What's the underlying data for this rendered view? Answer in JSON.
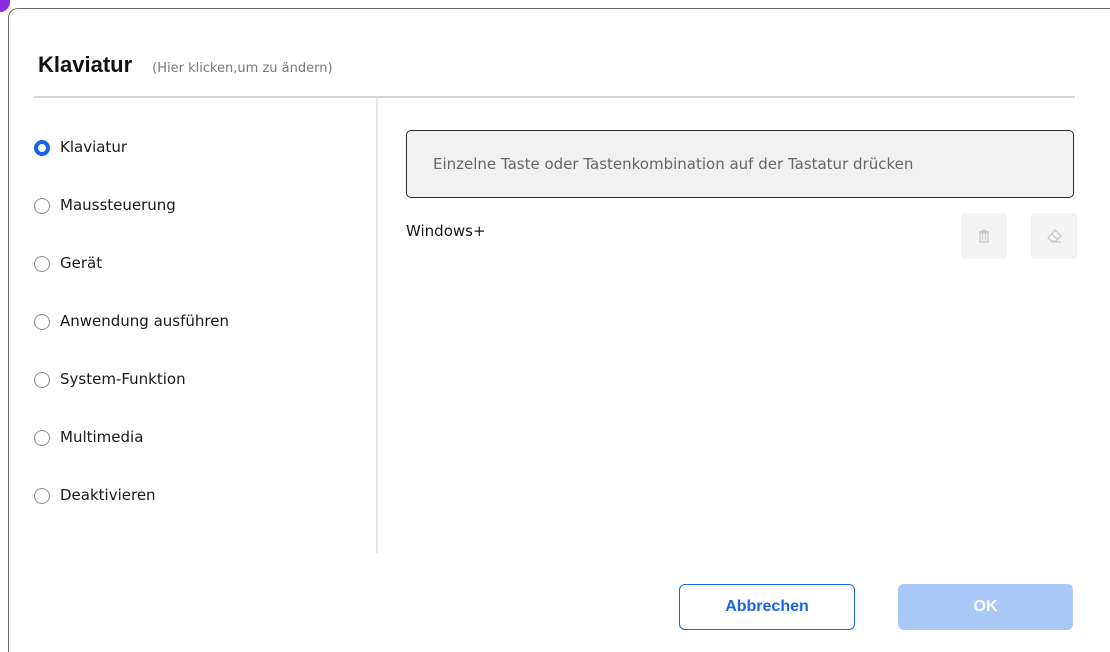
{
  "header": {
    "title": "Klaviatur",
    "hint": "(Hier klicken,um zu ändern)"
  },
  "options": [
    {
      "label": "Klaviatur",
      "selected": true
    },
    {
      "label": "Maussteuerung",
      "selected": false
    },
    {
      "label": "Gerät",
      "selected": false
    },
    {
      "label": "Anwendung ausführen",
      "selected": false
    },
    {
      "label": "System-Funktion",
      "selected": false
    },
    {
      "label": "Multimedia",
      "selected": false
    },
    {
      "label": "Deaktivieren",
      "selected": false
    }
  ],
  "key_input": {
    "value": "",
    "placeholder": "Einzelne Taste oder Tastenkombination auf der Tastatur drücken"
  },
  "combo": {
    "text": "Windows+"
  },
  "icons": {
    "delete": "trash-icon",
    "clear": "eraser-icon"
  },
  "buttons": {
    "cancel": "Abbrechen",
    "ok": "OK"
  },
  "colors": {
    "accent": "#1565e6",
    "ok_disabled": "#a9c8f5",
    "window_accent": "#8a2be2"
  }
}
